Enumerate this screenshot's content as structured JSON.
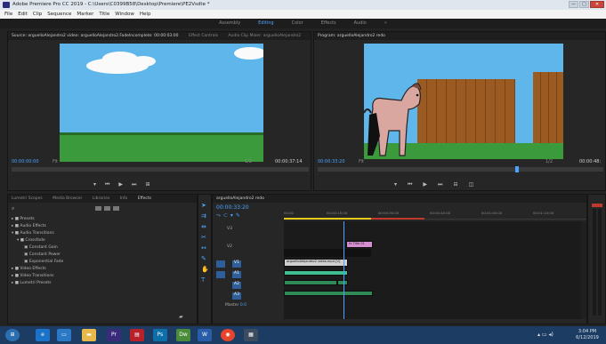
{
  "window": {
    "title": "Adobe Premiere Pro CC 2019 - C:\\Users\\C0399B58\\Desktop\\Premiere\\PE2Vsdte *",
    "controls": [
      "—",
      "□",
      "✕"
    ]
  },
  "menu": [
    "File",
    "Edit",
    "Clip",
    "Sequence",
    "Marker",
    "Title",
    "Window",
    "Help"
  ],
  "workspaces": {
    "items": [
      "Assembly",
      "Editing",
      "Color",
      "Effects",
      "Audio"
    ],
    "active": "Editing",
    "more": "»"
  },
  "source_monitor": {
    "tabs": [
      "Source: arguelloAlejandro2 video: arguelloAlejandro2.FadeIncomplete: 00:00:03:00",
      "Effect Controls",
      "Audio Clip Mixer: arguelloAlejandro2"
    ],
    "timecode_in": "00:00:00:00",
    "fit": "Fit",
    "timecode_out": "00:00:37:14",
    "resolution": "1/2"
  },
  "program_monitor": {
    "tab": "Program: arguelloAlejandro2 redo",
    "timecode": "00:00:33:20",
    "fit": "Fit",
    "resolution": "1/2",
    "timecode_out": "00:00:48:"
  },
  "effects_panel": {
    "tabs": [
      "Lumetri Scopes",
      "Media Browser",
      "Libraries",
      "Info",
      "Effects"
    ],
    "active_tab": "Effects",
    "tree": [
      "Presets",
      "Audio Effects",
      "Audio Transitions",
      "Crossfade",
      "Constant Gain",
      "Constant Power",
      "Exponential Fade",
      "Video Effects",
      "Video Transitions",
      "Lumetri Presets"
    ]
  },
  "timeline": {
    "tab": "arguelloAlejandro2 redo",
    "timecode": "00:00:33:20",
    "ruler": [
      "00:00",
      "00:00:15:00",
      "00:00:30:00",
      "00:00:45:00",
      "00:01:00:00",
      "00:01:15:00",
      "00:01:30:00"
    ],
    "tracks": [
      "V3",
      "V2",
      "V1",
      "A1",
      "A2",
      "A3"
    ],
    "master": "Master",
    "master_value": "0.0",
    "clips": {
      "title_clip": "fx Title 01",
      "video_clip": "arguelloAlejandro2 video.mp4 [V]"
    }
  },
  "taskbar": {
    "time": "3:04 PM",
    "date": "6/12/2019"
  }
}
